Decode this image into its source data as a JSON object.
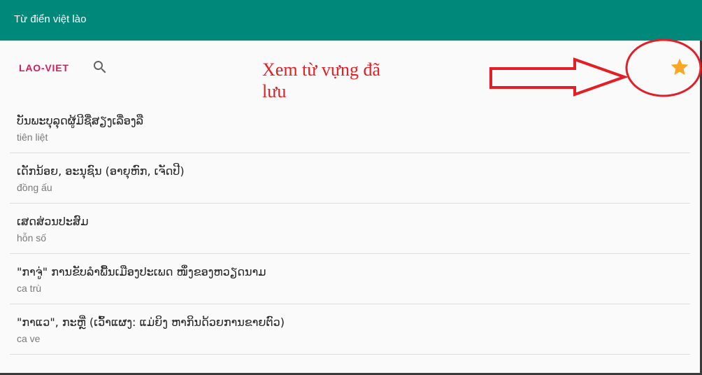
{
  "app_bar": {
    "title": "Từ điển việt lào",
    "background_color": "#00897b"
  },
  "toolbar": {
    "mode_label": "LAO-VIET",
    "mode_color": "#d81b60",
    "search_icon": "search-icon",
    "favorites_icon": "star-icon",
    "favorites_color": "#f9a825"
  },
  "annotation": {
    "text": "Xem từ vựng đã lưu",
    "color": "#e31e24",
    "arrow_icon": "right-arrow-outline",
    "highlight_shape": "ellipse"
  },
  "entries": [
    {
      "word": "ບັນພະບຸລຸດຜູ້ມີຊື່ສຽງເລື່ອງລື",
      "meaning": "tiên liệt"
    },
    {
      "word": "ເດັກນ້ອຍ, ອະນຸຊົນ (ອາຍຸຫົກ, ເຈັດປີ)",
      "meaning": "đồng ấu"
    },
    {
      "word": "ເສດສ່ວນປະສົມ",
      "meaning": "hỗn số"
    },
    {
      "word": "\"ກາຈູ່\" ການຂັບລຳພື້ນເມືອງປະເພດ ໜຶ່ງຂອງຫວຽດນາມ",
      "meaning": "ca trù"
    },
    {
      "word": "\"ກາແວ\", ກະຫຼີ່ (ເວົ້າແຜງ: ແມ່ຍິງ ຫາກິນດ້ວຍການຂາຍຕົວ)",
      "meaning": "ca ve"
    }
  ]
}
